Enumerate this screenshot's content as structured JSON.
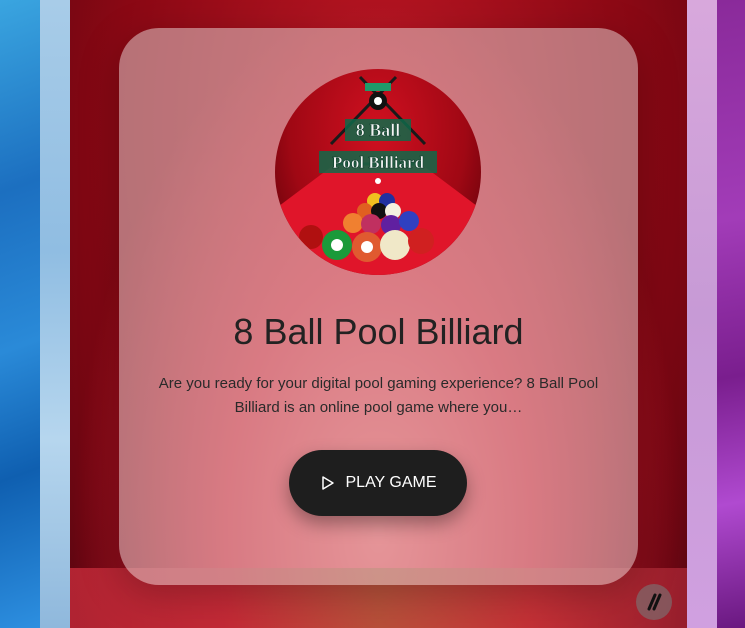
{
  "game": {
    "thumbnail_line1": "8 Ball",
    "thumbnail_line2": "Pool Billiard",
    "title": "8 Ball Pool Billiard",
    "description": "Are you ready for your digital pool gaming experience? 8 Ball Pool Billiard is an online pool game where you…",
    "play_label": "PLAY GAME",
    "play_icon": "play-icon"
  },
  "brand": {
    "icon": "slash-logo-icon"
  },
  "colors": {
    "card_bg": "#dcc8c8",
    "button_bg": "#1e1e1e",
    "button_text": "#ffffff",
    "felt": "#c8102e",
    "title_text": "#222222"
  }
}
